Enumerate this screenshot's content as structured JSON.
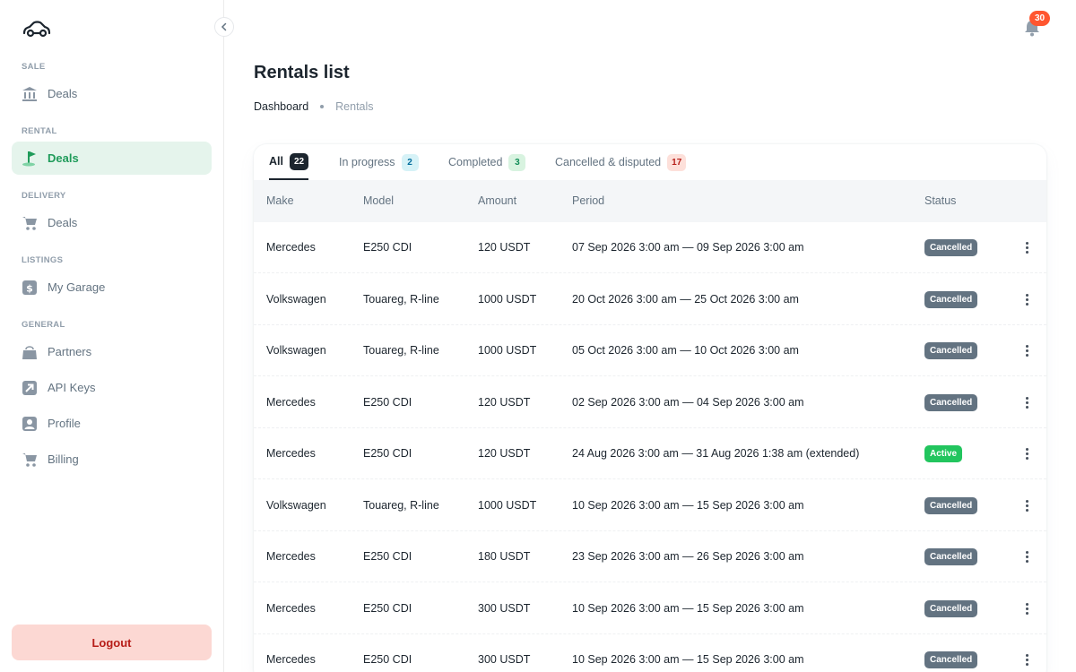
{
  "sidebar": {
    "sections": [
      {
        "title": "SALE",
        "items": [
          {
            "label": "Deals",
            "icon": "bank-icon"
          }
        ]
      },
      {
        "title": "RENTAL",
        "items": [
          {
            "label": "Deals",
            "icon": "flag-icon",
            "active": true
          }
        ]
      },
      {
        "title": "DELIVERY",
        "items": [
          {
            "label": "Deals",
            "icon": "cart-icon"
          }
        ]
      },
      {
        "title": "LISTINGS",
        "items": [
          {
            "label": "My Garage",
            "icon": "dollar-icon"
          }
        ]
      },
      {
        "title": "GENERAL",
        "items": [
          {
            "label": "Partners",
            "icon": "bag-icon"
          },
          {
            "label": "API Keys",
            "icon": "arrow-up-right-icon"
          },
          {
            "label": "Profile",
            "icon": "user-icon"
          },
          {
            "label": "Billing",
            "icon": "cart-icon"
          }
        ]
      }
    ],
    "logout_label": "Logout"
  },
  "header": {
    "notification_count": "30"
  },
  "page": {
    "title": "Rentals list",
    "breadcrumb": [
      "Dashboard",
      "Rentals"
    ]
  },
  "tabs": [
    {
      "label": "All",
      "count": "22"
    },
    {
      "label": "In progress",
      "count": "2"
    },
    {
      "label": "Completed",
      "count": "3"
    },
    {
      "label": "Cancelled & disputed",
      "count": "17"
    }
  ],
  "table": {
    "columns": [
      "Make",
      "Model",
      "Amount",
      "Period",
      "Status"
    ],
    "rows": [
      {
        "make": "Mercedes",
        "model": "E250 CDI",
        "amount": "120 USDT",
        "period": "07 Sep 2026 3:00 am — 09 Sep 2026 3:00 am",
        "status": "Cancelled"
      },
      {
        "make": "Volkswagen",
        "model": "Touareg, R-line",
        "amount": "1000 USDT",
        "period": "20 Oct 2026 3:00 am — 25 Oct 2026 3:00 am",
        "status": "Cancelled"
      },
      {
        "make": "Volkswagen",
        "model": "Touareg, R-line",
        "amount": "1000 USDT",
        "period": "05 Oct 2026 3:00 am — 10 Oct 2026 3:00 am",
        "status": "Cancelled"
      },
      {
        "make": "Mercedes",
        "model": "E250 CDI",
        "amount": "120 USDT",
        "period": "02 Sep 2026 3:00 am — 04 Sep 2026 3:00 am",
        "status": "Cancelled"
      },
      {
        "make": "Mercedes",
        "model": "E250 CDI",
        "amount": "120 USDT",
        "period": "24 Aug 2026 3:00 am — 31 Aug 2026 1:38 am (extended)",
        "status": "Active"
      },
      {
        "make": "Volkswagen",
        "model": "Touareg, R-line",
        "amount": "1000 USDT",
        "period": "10 Sep 2026 3:00 am — 15 Sep 2026 3:00 am",
        "status": "Cancelled"
      },
      {
        "make": "Mercedes",
        "model": "E250 CDI",
        "amount": "180 USDT",
        "period": "23 Sep 2026 3:00 am — 26 Sep 2026 3:00 am",
        "status": "Cancelled"
      },
      {
        "make": "Mercedes",
        "model": "E250 CDI",
        "amount": "300 USDT",
        "period": "10 Sep 2026 3:00 am — 15 Sep 2026 3:00 am",
        "status": "Cancelled"
      },
      {
        "make": "Mercedes",
        "model": "E250 CDI",
        "amount": "300 USDT",
        "period": "10 Sep 2026 3:00 am — 15 Sep 2026 3:00 am",
        "status": "Cancelled"
      }
    ]
  },
  "colors": {
    "accent": "#1f9b5a",
    "active_status": "#22c55e",
    "cancelled_status": "#637381",
    "logout_bg": "#fcd8d3",
    "badge": "#ff5630"
  }
}
